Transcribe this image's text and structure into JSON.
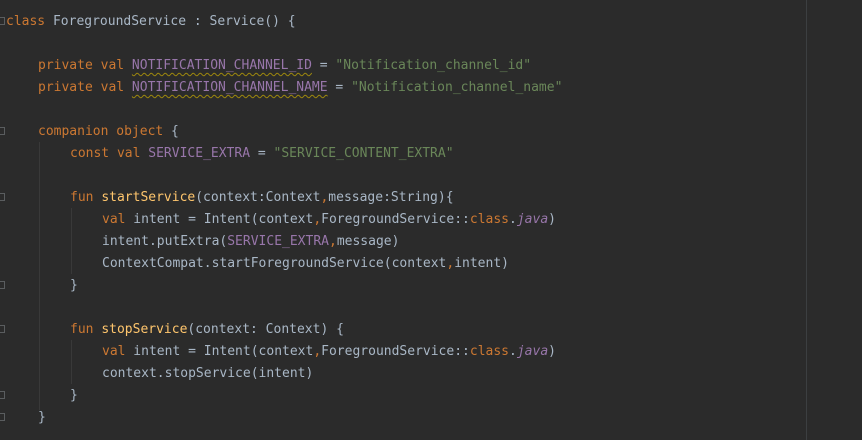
{
  "code": {
    "line1": {
      "kw_class": "class",
      "class_name": " ForegroundService : Service() {"
    },
    "line2": {
      "kw": "private val",
      "name": "NOTIFICATION_CHANNEL_ID",
      "eq": " = ",
      "value": "\"Notification_channel_id\""
    },
    "line3": {
      "kw": "private val",
      "name": "NOTIFICATION_CHANNEL_NAME",
      "eq": " = ",
      "value": "\"Notification_channel_name\""
    },
    "line4": {
      "kw": "companion object",
      "rest": " {"
    },
    "line5": {
      "kw": "const val",
      "name": "SERVICE_EXTRA",
      "eq": " = ",
      "value": "\"SERVICE_CONTENT_EXTRA\""
    },
    "line6": {
      "kw": "fun",
      "fn_name": "startService",
      "params": "(context:Context",
      "comma": ",",
      "params2": "message:String){"
    },
    "line7": {
      "kw": "val",
      "mid": " intent = Intent(context",
      "comma": ",",
      "ref": "ForegroundService::",
      "kw2": "class",
      "dot": ".",
      "java": "java",
      "close": ")"
    },
    "line8": {
      "start": "intent.putExtra(",
      "const": "SERVICE_EXTRA",
      "comma": ",",
      "end": "message)"
    },
    "line9": {
      "start": "ContextCompat.startForegroundService(context",
      "comma": ",",
      "end": "intent)"
    },
    "line10": {
      "text": "}"
    },
    "line11": {
      "kw": "fun",
      "fn_name": "stopService",
      "params": "(context: Context) {"
    },
    "line12": {
      "kw": "val",
      "mid": " intent = Intent(context",
      "comma": ",",
      "ref": "ForegroundService::",
      "kw2": "class",
      "dot": ".",
      "java": "java",
      "close": ")"
    },
    "line13": {
      "text": "context.stopService(intent)"
    },
    "line14": {
      "text": "}"
    },
    "line15": {
      "text": "}"
    }
  },
  "colors": {
    "background": "#2b2b2b",
    "keyword": "#cc7832",
    "string": "#6a8759",
    "constant": "#9876aa",
    "function": "#ffc66d",
    "default_text": "#a9b7c6"
  }
}
